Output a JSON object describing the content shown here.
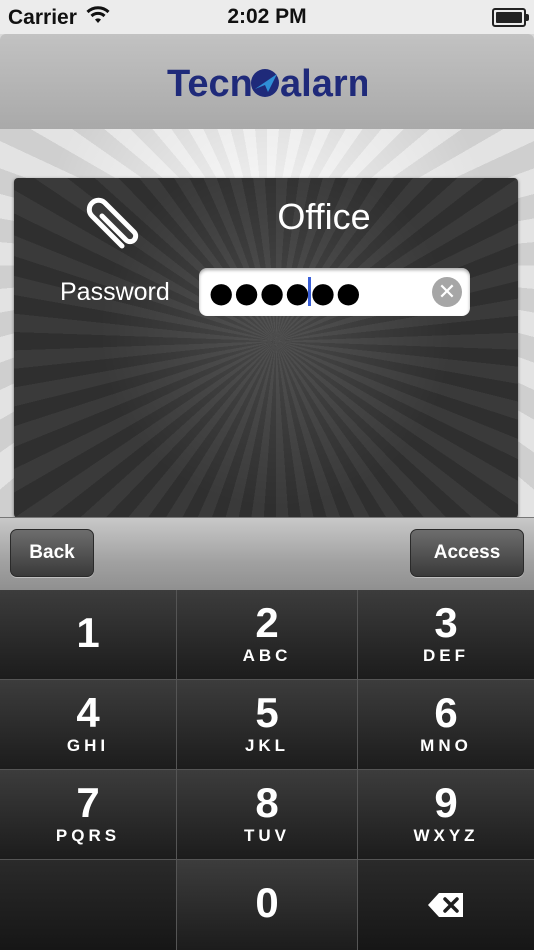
{
  "status_bar": {
    "carrier": "Carrier",
    "time": "2:02 PM"
  },
  "header": {
    "logo_text_left": "Tecn",
    "logo_text_right": "alarm"
  },
  "panel": {
    "title": "Office",
    "password_label": "Password",
    "password_value": "●●●●●●"
  },
  "toolbar": {
    "back_label": "Back",
    "access_label": "Access"
  },
  "keypad": {
    "keys": [
      {
        "num": "1",
        "letters": ""
      },
      {
        "num": "2",
        "letters": "ABC"
      },
      {
        "num": "3",
        "letters": "DEF"
      },
      {
        "num": "4",
        "letters": "GHI"
      },
      {
        "num": "5",
        "letters": "JKL"
      },
      {
        "num": "6",
        "letters": "MNO"
      },
      {
        "num": "7",
        "letters": "PQRS"
      },
      {
        "num": "8",
        "letters": "TUV"
      },
      {
        "num": "9",
        "letters": "WXYZ"
      },
      {
        "num": "0",
        "letters": ""
      }
    ]
  },
  "colors": {
    "brand": "#1f2a7a",
    "caret": "#3a5fd8"
  }
}
